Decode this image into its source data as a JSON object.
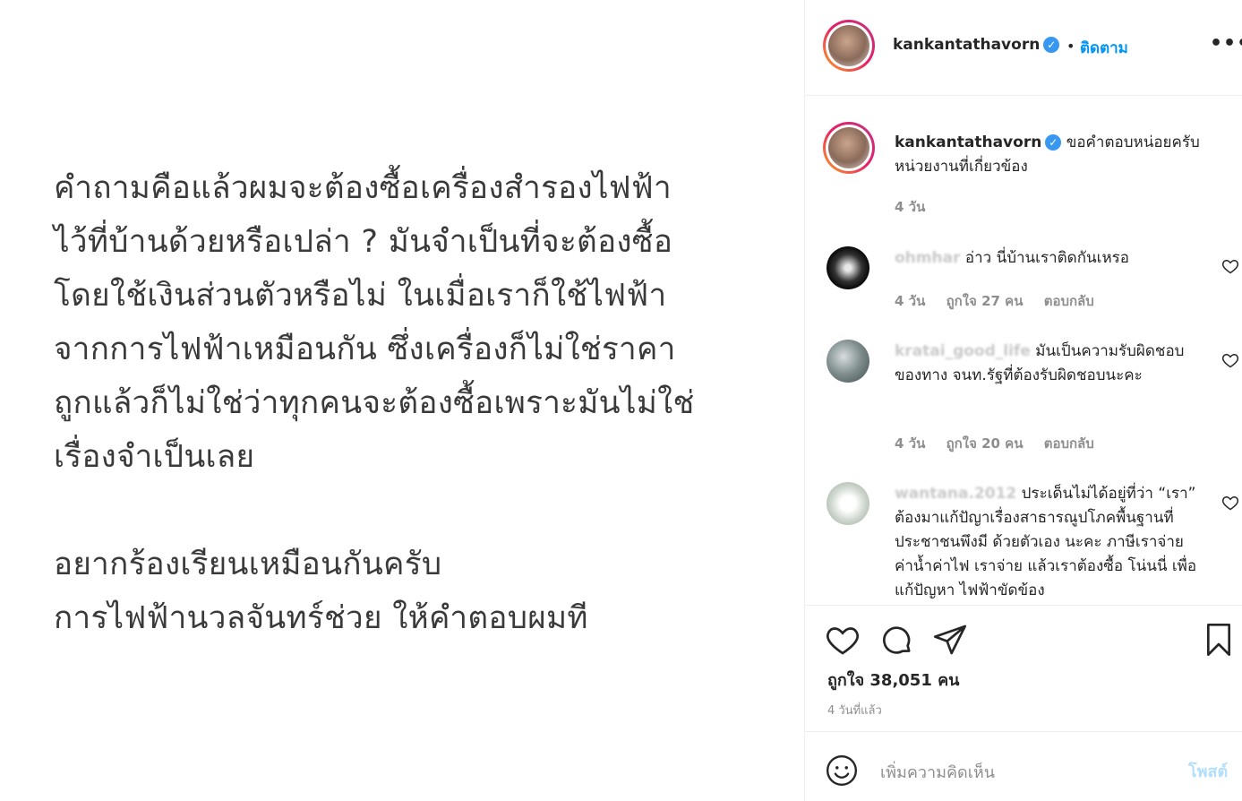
{
  "post_image": {
    "paragraph1": [
      "คำถามคือแล้วผมจะต้องซื้อเครื่องสำรองไฟฟ้า",
      "ไว้ที่บ้านด้วยหรือเปล่า ? มันจำเป็นที่จะต้องซื้อ",
      "โดยใช้เงินส่วนตัวหรือไม่  ในเมื่อเราก็ใช้ไฟฟ้า",
      "จากการไฟฟ้าเหมือนกัน ซึ่งเครื่องก็ไม่ใช่ราคา",
      "ถูกแล้วก็ไม่ใช่ว่าทุกคนจะต้องซื้อเพราะมันไม่ใช่",
      "เรื่องจำเป็นเลย"
    ],
    "paragraph2": [
      "อยากร้องเรียนเหมือนกันครับ",
      "การไฟฟ้านวลจันทร์ช่วย ให้คำตอบผมที"
    ]
  },
  "header": {
    "username": "kankantathavorn",
    "dot": "•",
    "follow_label": "ติดตาม",
    "more_icon": "more-icon"
  },
  "caption": {
    "username": "kankantathavorn",
    "text": "ขอคำตอบหน่อยครับ หน่วยงานที่เกี่ยวข้อง",
    "time": "4 วัน"
  },
  "comments": [
    {
      "username": "ohmhar",
      "text": "อ่าว นี่บ้านเราติดกันเหรอ",
      "time": "4 วัน",
      "likes": "ถูกใจ 27 คน",
      "reply": "ตอบกลับ"
    },
    {
      "username": "kratai_good_life",
      "text": "มันเป็นความรับผิดชอบ ของทาง จนท.รัฐที่ต้องรับผิดชอบนะคะ",
      "time": "4 วัน",
      "likes": "ถูกใจ 20 คน",
      "reply": "ตอบกลับ"
    },
    {
      "username": "wantana.2012",
      "text": "ประเด็นไม่ได้อยู่ที่ว่า “เรา” ต้องมาแก้ปัญาเรื่องสาธารณูปโภคพื้นฐานที่ประชาชนพึงมี ด้วยตัวเอง นะคะ ภาษีเราจ่าย ค่าน้ำค่าไฟ เราจ่าย แล้วเราต้องซื้อ โน่นนี่ เพื่อแก้ปัญหา ไฟฟ้าขัดข้อง"
    }
  ],
  "actions": {
    "likes": "ถูกใจ 38,051 คน",
    "posted": "4 วันที่แล้ว"
  },
  "add_comment": {
    "placeholder": "เพิ่มความคิดเห็น",
    "post_label": "โพสต์"
  },
  "colors": {
    "accent": "#0095f6",
    "verified": "#3897f0",
    "muted": "#8e8e8e"
  }
}
